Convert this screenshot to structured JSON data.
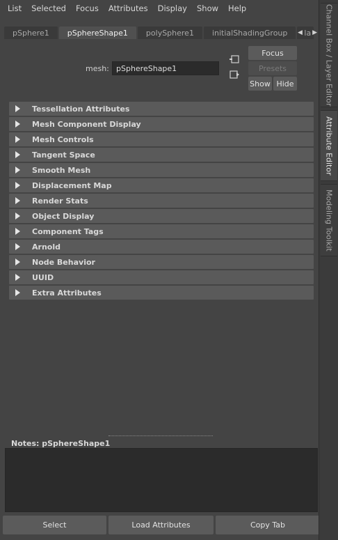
{
  "menu": [
    "List",
    "Selected",
    "Focus",
    "Attributes",
    "Display",
    "Show",
    "Help"
  ],
  "tabs": [
    {
      "label": "pSphere1",
      "active": false
    },
    {
      "label": "pSphereShape1",
      "active": true
    },
    {
      "label": "polySphere1",
      "active": false
    },
    {
      "label": "initialShadingGroup",
      "active": false
    },
    {
      "label": "la",
      "active": false
    }
  ],
  "mesh": {
    "label": "mesh:",
    "value": "pSphereShape1"
  },
  "buttons": {
    "focus": "Focus",
    "presets": "Presets",
    "show": "Show",
    "hide": "Hide"
  },
  "sections": [
    "Tessellation Attributes",
    "Mesh Component Display",
    "Mesh Controls",
    "Tangent Space",
    "Smooth Mesh",
    "Displacement Map",
    "Render Stats",
    "Object Display",
    "Component Tags",
    "Arnold",
    "Node Behavior",
    "UUID",
    "Extra Attributes"
  ],
  "notes": {
    "label": "Notes:  pSphereShape1",
    "value": ""
  },
  "bottom": {
    "select": "Select",
    "load": "Load Attributes",
    "copy": "Copy Tab"
  },
  "side_tabs": [
    {
      "label": "Channel Box / Layer Editor",
      "active": false
    },
    {
      "label": "Attribute Editor",
      "active": true
    },
    {
      "label": "Modeling Toolkit",
      "active": false
    }
  ]
}
